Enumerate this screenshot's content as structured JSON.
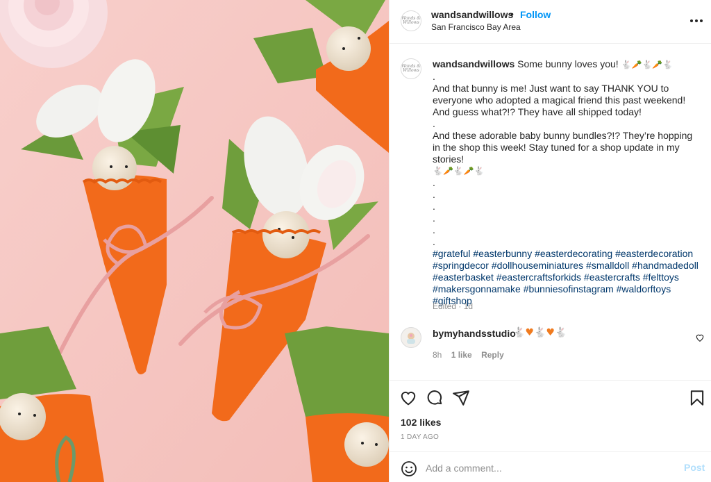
{
  "post": {
    "username": "wandsandwillows",
    "avatar_text": "Wands & Willows",
    "follow_label": "Follow",
    "location": "San Francisco Bay Area",
    "photo_alt": "Felt carrots with wooden bunny dolls on a pink background"
  },
  "caption": {
    "username": "wandsandwillows",
    "text": "Some bunny loves you!",
    "emoji_suffix": [
      "bunny",
      "carrot",
      "bunny",
      "carrot",
      "bunny"
    ],
    "lines": [
      ".",
      "And that bunny is me! Just want to say THANK YOU to everyone who adopted a magical friend this past weekend! And guess what?!? They have all shipped today!",
      ".",
      "And these adorable baby bunny bundles?!? They’re hopping in the shop this week! Stay tuned for a shop update in my stories!"
    ],
    "emoji_line": [
      "bunny",
      "carrot",
      "bunny",
      "carrot",
      "bunny"
    ],
    "dots": [
      ".",
      ".",
      ".",
      ".",
      ".",
      "."
    ],
    "hashtags": [
      "#grateful",
      "#easterbunny",
      "#easterdecorating",
      "#easterdecoration",
      "#springdecor",
      "#dollhouseminiatures",
      "#smalldoll",
      "#handmadedoll",
      "#easterbasket",
      "#eastercraftsforkids",
      "#eastercrafts",
      "#felttoys",
      "#makersgonnamake",
      "#bunniesofinstagram",
      "#waldorftoys",
      "#giftshop"
    ],
    "edited": "Edited · 1d"
  },
  "comment": {
    "username": "bymyhandsstudio",
    "emoji": [
      "bunny",
      "orange-heart",
      "bunny",
      "orange-heart",
      "bunny"
    ],
    "age": "8h",
    "likes": "1 like",
    "reply_label": "Reply"
  },
  "actions": {
    "likes": "102 likes",
    "date": "1 DAY AGO",
    "icons": [
      "heart-icon",
      "comment-icon",
      "share-icon",
      "bookmark-icon"
    ]
  },
  "add_comment": {
    "placeholder": "Add a comment...",
    "post_label": "Post",
    "emoji_icon": "smiley-icon"
  },
  "colors": {
    "follow": "#0095f6",
    "hashtag": "#00376b",
    "post_disabled": "#b2dffc",
    "muted": "#8e8e8e"
  }
}
